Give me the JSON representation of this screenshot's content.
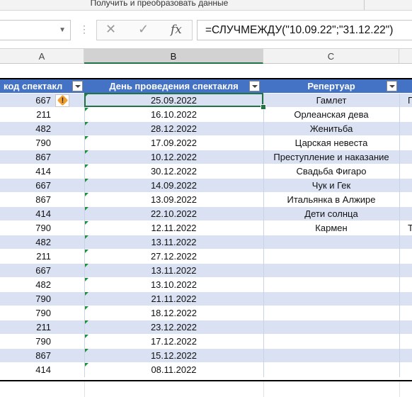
{
  "ribbon": {
    "group_label": "Получить и преобразовать данные"
  },
  "formula_bar": {
    "name_box": "",
    "cancel_icon": "x-icon",
    "enter_icon": "checkmark-icon",
    "fx_label": "fx",
    "formula": "=СЛУЧМЕЖДУ(\"10.09.22\";\"31.12.22\")"
  },
  "columns": [
    "A",
    "B",
    "C"
  ],
  "selected_column": "B",
  "table": {
    "headers": [
      "код спектакл",
      "День проведения спектакля",
      "Репертуар"
    ],
    "rows": [
      {
        "code": "667",
        "date": "25.09.2022",
        "rep": "Гамлет",
        "d": "Г"
      },
      {
        "code": "211",
        "date": "16.10.2022",
        "rep": "Орлеанская дева",
        "d": ""
      },
      {
        "code": "482",
        "date": "28.12.2022",
        "rep": "Женитьба",
        "d": ""
      },
      {
        "code": "790",
        "date": "17.09.2022",
        "rep": "Царская невеста",
        "d": ""
      },
      {
        "code": "867",
        "date": "10.12.2022",
        "rep": "Преступление и наказание",
        "d": ""
      },
      {
        "code": "414",
        "date": "30.12.2022",
        "rep": "Свадьба Фигаро",
        "d": ""
      },
      {
        "code": "667",
        "date": "14.09.2022",
        "rep": "Чук и Гек",
        "d": ""
      },
      {
        "code": "867",
        "date": "13.09.2022",
        "rep": "Итальянка в Алжире",
        "d": ""
      },
      {
        "code": "414",
        "date": "22.10.2022",
        "rep": "Дети солнца",
        "d": ""
      },
      {
        "code": "790",
        "date": "12.11.2022",
        "rep": "Кармен",
        "d": "Т"
      },
      {
        "code": "482",
        "date": "13.11.2022",
        "rep": "",
        "d": ""
      },
      {
        "code": "211",
        "date": "27.12.2022",
        "rep": "",
        "d": ""
      },
      {
        "code": "667",
        "date": "13.11.2022",
        "rep": "",
        "d": ""
      },
      {
        "code": "482",
        "date": "13.10.2022",
        "rep": "",
        "d": ""
      },
      {
        "code": "790",
        "date": "21.11.2022",
        "rep": "",
        "d": ""
      },
      {
        "code": "790",
        "date": "18.12.2022",
        "rep": "",
        "d": ""
      },
      {
        "code": "211",
        "date": "23.12.2022",
        "rep": "",
        "d": ""
      },
      {
        "code": "790",
        "date": "17.12.2022",
        "rep": "",
        "d": ""
      },
      {
        "code": "867",
        "date": "15.12.2022",
        "rep": "",
        "d": ""
      },
      {
        "code": "414",
        "date": "08.11.2022",
        "rep": "",
        "d": ""
      }
    ]
  },
  "warning_icon": "exclamation-diamond-icon",
  "warning_glyph": "!",
  "colors": {
    "header": "#4472c4",
    "band": "#d9e1f2",
    "accent": "#217346"
  }
}
